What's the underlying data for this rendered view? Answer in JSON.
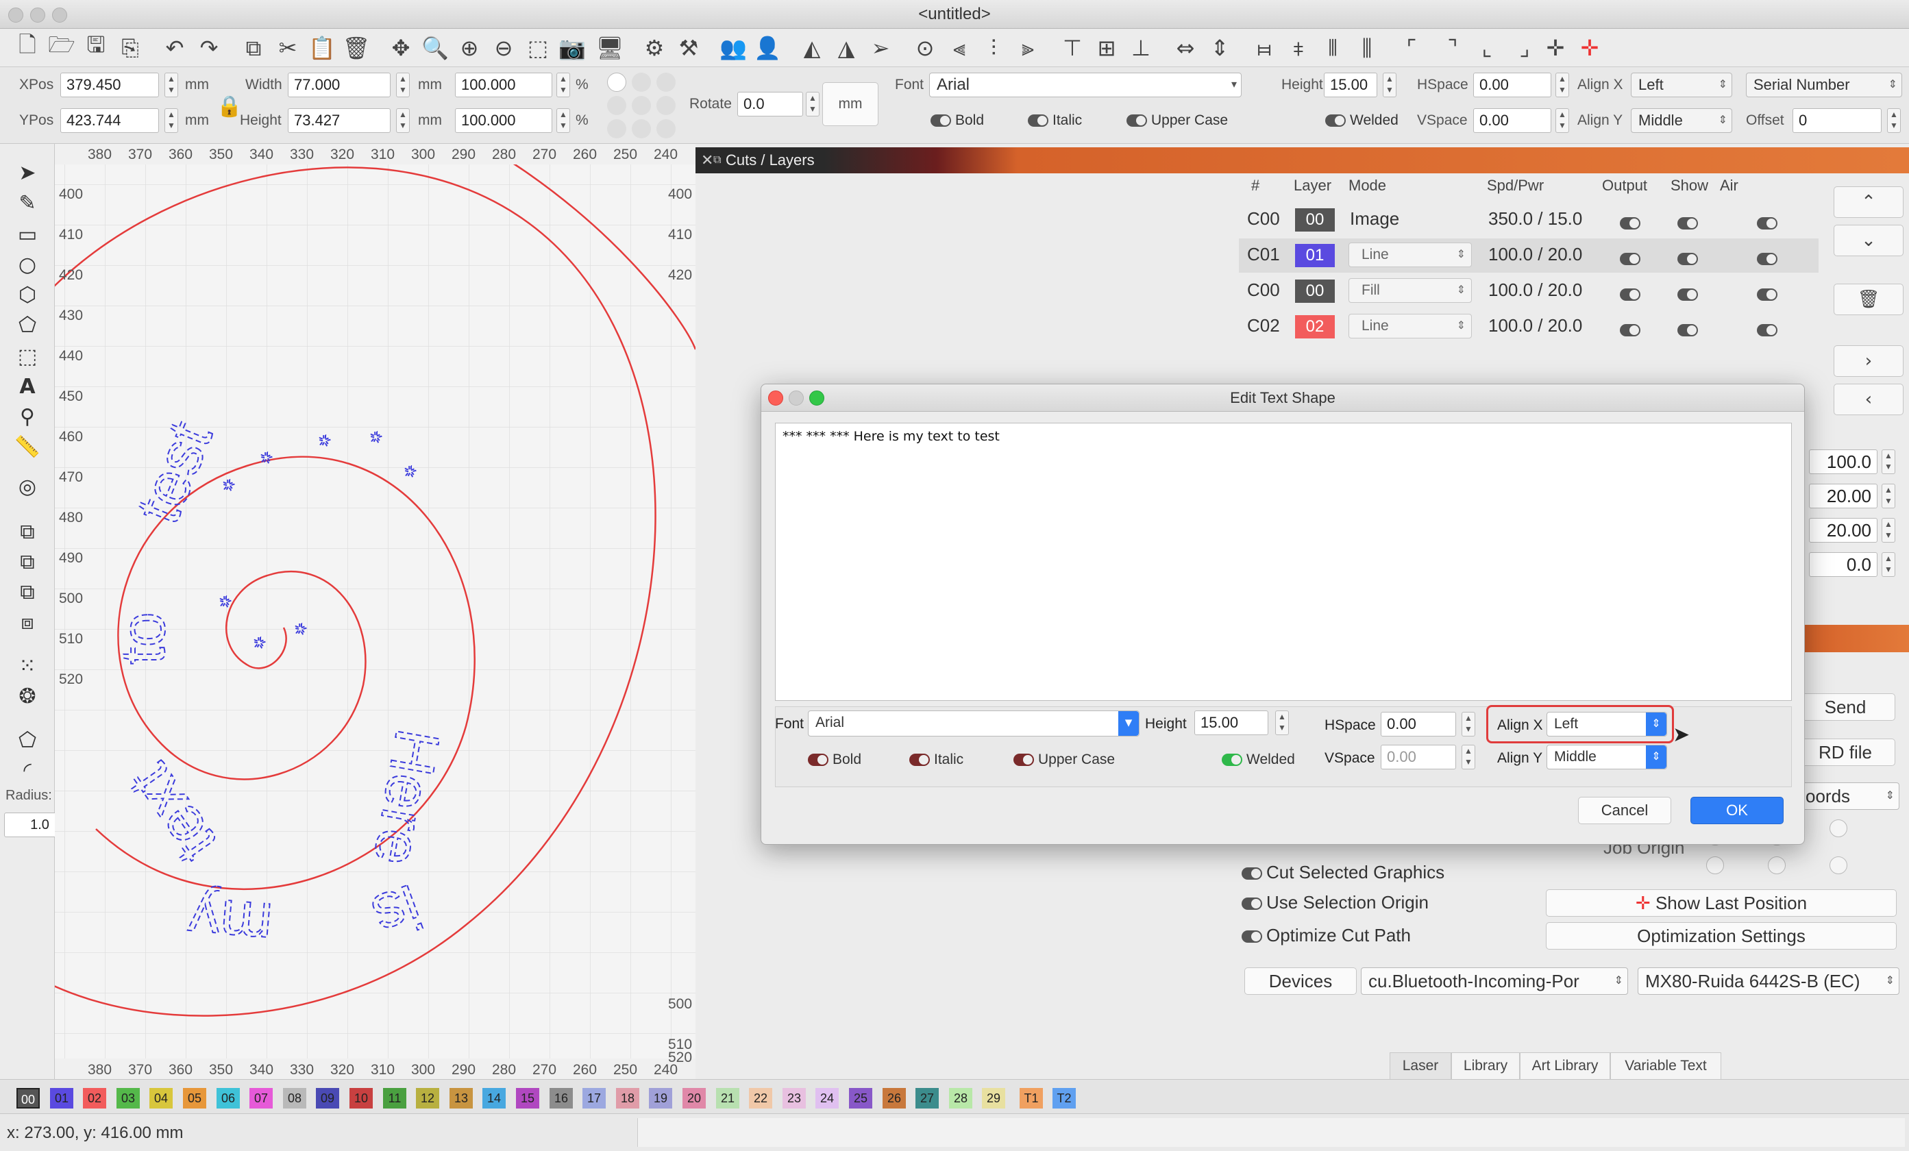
{
  "window": {
    "title": "<untitled>"
  },
  "props": {
    "xpos_label": "XPos",
    "xpos": "379.450",
    "ypos_label": "YPos",
    "ypos": "423.744",
    "unit_mm": "mm",
    "width_label": "Width",
    "width": "77.000",
    "height_label": "Height",
    "height": "73.427",
    "scale_x": "100.000",
    "scale_y": "100.000",
    "pct": "%",
    "rotate_label": "Rotate",
    "rotate": "0.0",
    "mm_button": "mm",
    "font_label": "Font",
    "font": "Arial",
    "text_height_label": "Height",
    "text_height": "15.00",
    "hspace_label": "HSpace",
    "hspace": "0.00",
    "vspace_label": "VSpace",
    "vspace": "0.00",
    "alignx_label": "Align X",
    "alignx": "Left",
    "aligny_label": "Align Y",
    "aligny": "Middle",
    "serial": "Serial Number",
    "offset_label": "Offset",
    "offset": "0",
    "bold": "Bold",
    "italic": "Italic",
    "upper": "Upper Case",
    "welded": "Welded"
  },
  "lefttools": {
    "radius_label": "Radius:",
    "radius": "1.0"
  },
  "ruler": {
    "top": [
      "380",
      "370",
      "360",
      "350",
      "340",
      "330",
      "320",
      "310",
      "300",
      "290",
      "280",
      "270",
      "260",
      "250",
      "240"
    ],
    "left": [
      "400",
      "410",
      "420",
      "430",
      "440",
      "450",
      "460",
      "470",
      "480",
      "490",
      "500",
      "510",
      "520"
    ],
    "right": [
      "400",
      "410",
      "420",
      "500",
      "510",
      "520"
    ]
  },
  "cuts": {
    "title": "Cuts / Layers",
    "headers": [
      "#",
      "Layer",
      "Mode",
      "Spd/Pwr",
      "Output",
      "Show",
      "Air"
    ],
    "rows": [
      {
        "id": "C00",
        "layer": "00",
        "color": "#555555",
        "mode": "Image",
        "spd": "350.0 / 15.0"
      },
      {
        "id": "C01",
        "layer": "01",
        "color": "#5a4ae0",
        "mode": "Line",
        "spd": "100.0 / 20.0"
      },
      {
        "id": "C00",
        "layer": "00",
        "color": "#555555",
        "mode": "Fill",
        "spd": "100.0 / 20.0"
      },
      {
        "id": "C02",
        "layer": "02",
        "color": "#f25c5c",
        "mode": "Line",
        "spd": "100.0 / 20.0"
      }
    ]
  },
  "rightpanel": {
    "values": [
      "100.0",
      "20.00",
      "20.00",
      "0.0"
    ],
    "send": "Send",
    "rdfile": "RD file",
    "coords": "oords",
    "job_origin": "Job Origin",
    "cut_selected": "Cut Selected Graphics",
    "use_sel_origin": "Use Selection Origin",
    "optimize": "Optimize Cut Path",
    "show_last": "Show Last Position",
    "opt_settings": "Optimization Settings",
    "devices": "Devices",
    "port": "cu.Bluetooth-Incoming-Por",
    "machine": "MX80-Ruida 6442S-B (EC)",
    "tabs": [
      "Laser",
      "Library",
      "Art Library",
      "Variable Text"
    ]
  },
  "palette": [
    {
      "n": "00",
      "c": "#555555"
    },
    {
      "n": "01",
      "c": "#5a4ae0"
    },
    {
      "n": "02",
      "c": "#f25c5c"
    },
    {
      "n": "03",
      "c": "#54b84a"
    },
    {
      "n": "04",
      "c": "#d8c63c"
    },
    {
      "n": "05",
      "c": "#e7973a"
    },
    {
      "n": "06",
      "c": "#3fc2d8"
    },
    {
      "n": "07",
      "c": "#e65ad8"
    },
    {
      "n": "08",
      "c": "#b9b9b9"
    },
    {
      "n": "09",
      "c": "#4a4ab4"
    },
    {
      "n": "10",
      "c": "#c84040"
    },
    {
      "n": "11",
      "c": "#4aa040"
    },
    {
      "n": "12",
      "c": "#b8b040"
    },
    {
      "n": "13",
      "c": "#c89440"
    },
    {
      "n": "14",
      "c": "#48a8e0"
    },
    {
      "n": "15",
      "c": "#b048c0"
    },
    {
      "n": "16",
      "c": "#8c8c8c"
    },
    {
      "n": "17",
      "c": "#9ca8e0"
    },
    {
      "n": "18",
      "c": "#e09ca8"
    },
    {
      "n": "19",
      "c": "#a0a0d8"
    },
    {
      "n": "20",
      "c": "#e088a8"
    },
    {
      "n": "21",
      "c": "#b8e0b0"
    },
    {
      "n": "22",
      "c": "#f0c8a8"
    },
    {
      "n": "23",
      "c": "#e8c0e0"
    },
    {
      "n": "24",
      "c": "#e0c0f0"
    },
    {
      "n": "25",
      "c": "#8858c8"
    },
    {
      "n": "26",
      "c": "#c8783c"
    },
    {
      "n": "27",
      "c": "#3c8c8c"
    },
    {
      "n": "28",
      "c": "#b8e8a8"
    },
    {
      "n": "29",
      "c": "#e8e0a0"
    },
    {
      "n": "T1",
      "c": "#f0a060"
    },
    {
      "n": "T2",
      "c": "#60a0f0"
    }
  ],
  "status": {
    "coords": "x: 273.00, y: 416.00 mm"
  },
  "dialog": {
    "title": "Edit Text Shape",
    "text": "*** *** *** Here is my text to test",
    "font_label": "Font",
    "font": "Arial",
    "height_label": "Height",
    "height": "15.00",
    "hspace_label": "HSpace",
    "hspace": "0.00",
    "vspace_label": "VSpace",
    "vspace": "0.00",
    "alignx_label": "Align X",
    "alignx": "Left",
    "aligny_label": "Align Y",
    "aligny": "Middle",
    "bold": "Bold",
    "italic": "Italic",
    "upper": "Upper Case",
    "welded": "Welded",
    "cancel": "Cancel",
    "ok": "OK"
  }
}
